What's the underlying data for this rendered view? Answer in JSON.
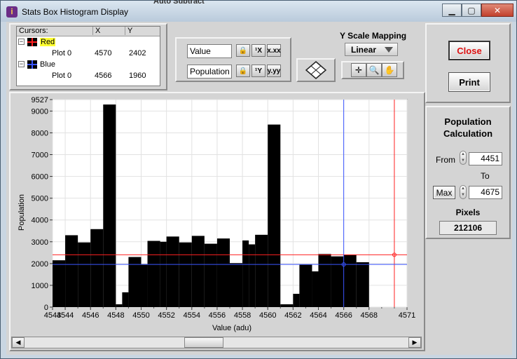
{
  "window": {
    "title": "Stats Box Histogram Display",
    "behind_title": "Auto Subtract",
    "controls": {
      "minimize": "▁",
      "maximize": "▢",
      "close": "✕"
    }
  },
  "cursors": {
    "header": {
      "name": "Cursors:",
      "x": "X",
      "y": "Y"
    },
    "items": [
      {
        "name": "Red",
        "plot": "Plot 0",
        "x": "4570",
        "y": "2402",
        "color": "#ff2020"
      },
      {
        "name": "Blue",
        "plot": "Plot 0",
        "x": "4566",
        "y": "1960",
        "color": "#3a55ff"
      }
    ]
  },
  "axis_controls": {
    "x_label_field": "Value",
    "y_label_field": "Population",
    "lock_icon": "lock-icon",
    "format_icons": [
      "x-scale-format-icon",
      "x-precision-icon",
      "y-scale-format-icon",
      "y-precision-icon"
    ]
  },
  "y_scale": {
    "label": "Y Scale Mapping",
    "value": "Linear"
  },
  "tools": [
    "crosshair-cursor-icon",
    "zoom-icon",
    "pan-hand-icon"
  ],
  "buttons": {
    "close": "Close",
    "print": "Print"
  },
  "population_calc": {
    "title": "Population Calculation",
    "from_label": "From",
    "from_value": "4451",
    "to_label": "To",
    "max_button": "Max",
    "to_value": "4675",
    "pixels_label": "Pixels",
    "pixels_value": "212106"
  },
  "chart_data": {
    "type": "bar",
    "xlabel": "Value (adu)",
    "ylabel": "Population",
    "xlim": [
      4543,
      4571
    ],
    "ylim": [
      0,
      9527
    ],
    "x_ticks": [
      "4543",
      "4544",
      "4546",
      "4548",
      "4550",
      "4552",
      "4554",
      "4556",
      "4558",
      "4560",
      "4562",
      "4564",
      "4566",
      "4568",
      "4571"
    ],
    "y_ticks": [
      "0",
      "1000",
      "2000",
      "3000",
      "4000",
      "5000",
      "6000",
      "7000",
      "8000",
      "9000",
      "9527"
    ],
    "bar_starts": [
      4543,
      4544,
      4545,
      4546,
      4547,
      4548,
      4548.5,
      4549,
      4550,
      4550.5,
      4551.5,
      4552,
      4553,
      4554,
      4555,
      4556,
      4557,
      4558,
      4558.5,
      4559,
      4560,
      4561,
      4562,
      4562.5,
      4563.5,
      4564,
      4565,
      4566,
      4567,
      4568,
      4569,
      4570
    ],
    "values": [
      2150,
      3300,
      2970,
      3580,
      9300,
      130,
      680,
      2300,
      1970,
      3040,
      3000,
      3240,
      2970,
      3270,
      2910,
      3150,
      2020,
      3060,
      2880,
      3320,
      8380,
      130,
      610,
      1960,
      1640,
      2440,
      2330,
      2400,
      2060
    ],
    "grid": true,
    "cursors": [
      {
        "name": "Red",
        "x": 4570,
        "y": 2402,
        "color": "#ff2020"
      },
      {
        "name": "Blue",
        "x": 4566,
        "y": 1960,
        "color": "#3a55ff"
      }
    ]
  }
}
